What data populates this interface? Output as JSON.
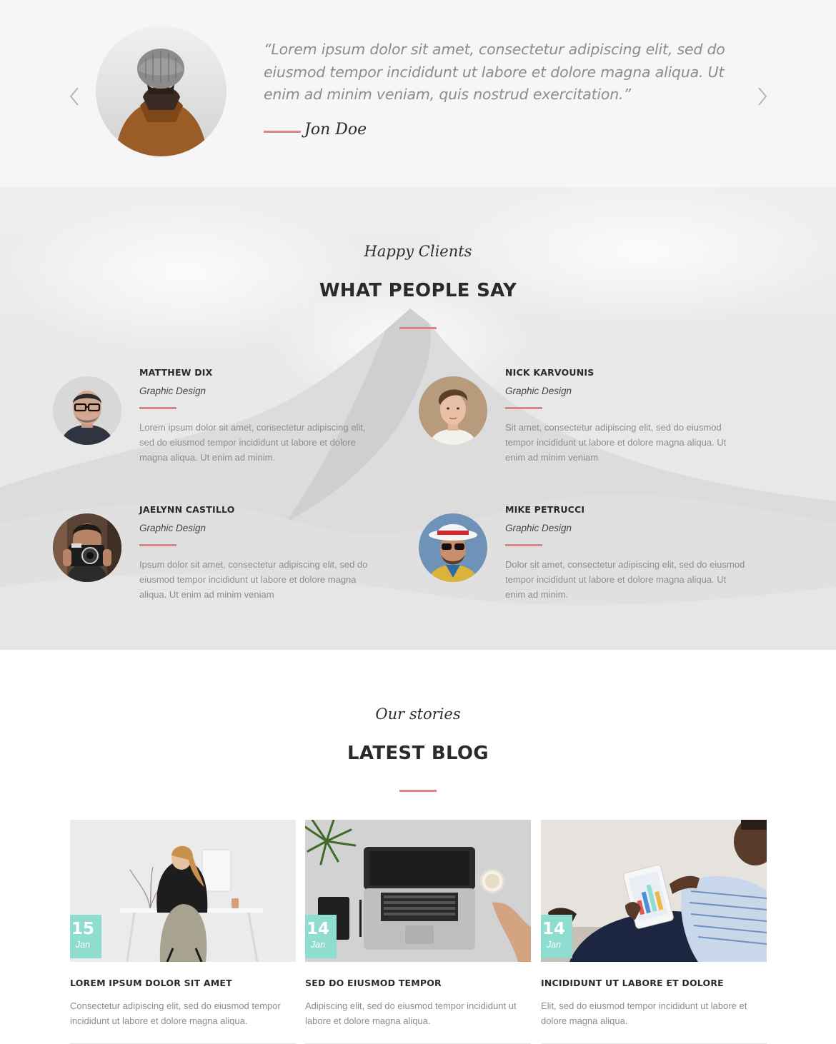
{
  "hero_testimonial": {
    "quote": "“Lorem ipsum dolor sit amet, consectetur adipiscing elit, sed do eiusmod tempor incididunt ut labore et dolore magna aliqua. Ut enim ad minim veniam, quis nostrud exercitation.”",
    "author": "Jon Doe",
    "prev_icon": "chevron-left-icon",
    "next_icon": "chevron-right-icon"
  },
  "clients_section": {
    "script_title": "Happy Clients",
    "title": "WHAT PEOPLE SAY",
    "testimonials": [
      {
        "name": "MATTHEW DIX",
        "role": "Graphic Design",
        "text": "Lorem ipsum dolor sit amet, consectetur adipiscing elit, sed do eiusmod tempor incididunt ut labore et dolore magna aliqua. Ut enim ad minim."
      },
      {
        "name": "NICK KARVOUNIS",
        "role": "Graphic Design",
        "text": "Sit amet, consectetur adipiscing elit, sed do eiusmod tempor incididunt ut labore et dolore magna aliqua. Ut enim ad minim veniam"
      },
      {
        "name": "JAELYNN CASTILLO",
        "role": "Graphic Design",
        "text": "Ipsum dolor sit amet, consectetur adipiscing elit, sed do eiusmod tempor incididunt ut labore et dolore magna aliqua. Ut enim ad minim veniam"
      },
      {
        "name": "MIKE PETRUCCI",
        "role": "Graphic Design",
        "text": "Dolor sit amet, consectetur adipiscing elit, sed do eiusmod tempor incididunt ut labore et dolore magna aliqua. Ut enim ad minim."
      }
    ]
  },
  "blog_section": {
    "script_title": "Our stories",
    "title": "LATEST BLOG",
    "posts": [
      {
        "day": "15",
        "month": "Jan",
        "title": "LOREM IPSUM DOLOR SIT AMET",
        "excerpt": "Consectetur adipiscing elit, sed do eiusmod tempor incididunt ut labore et dolore magna aliqua."
      },
      {
        "day": "14",
        "month": "Jan",
        "title": "SED DO EIUSMOD TEMPOR",
        "excerpt": "Adipiscing elit, sed do eiusmod tempor incididunt ut labore et dolore magna aliqua."
      },
      {
        "day": "14",
        "month": "Jan",
        "title": "INCIDIDUNT UT LABORE ET DOLORE",
        "excerpt": "Elit, sed do eiusmod tempor incididunt ut labore et dolore magna aliqua."
      }
    ]
  },
  "colors": {
    "accent_rule": "#d9858a",
    "date_badge": "#8fdcd0",
    "heading": "#2a2a2a",
    "body_text": "#8d8d8d"
  }
}
